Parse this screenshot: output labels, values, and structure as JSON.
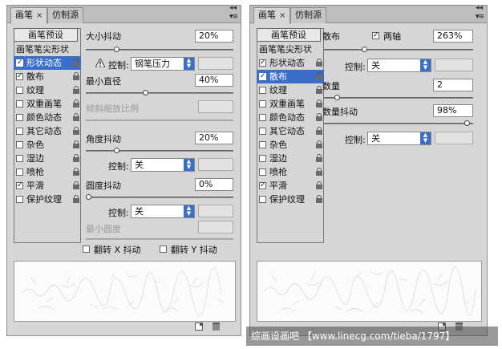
{
  "left_panel": {
    "tabs": [
      {
        "label": "画笔",
        "close": "×",
        "active": true
      },
      {
        "label": "仿制源",
        "active": false
      }
    ],
    "presets_button": "画笔预设",
    "list_header": "画笔笔尖形状",
    "items": [
      {
        "label": "形状动态",
        "checked": true,
        "selected": true
      },
      {
        "label": "散布",
        "checked": true,
        "selected": false
      },
      {
        "label": "纹理",
        "checked": false,
        "selected": false
      },
      {
        "label": "双重画笔",
        "checked": false,
        "selected": false
      },
      {
        "label": "颜色动态",
        "checked": false,
        "selected": false
      },
      {
        "label": "其它动态",
        "checked": false,
        "selected": false
      },
      {
        "label": "杂色",
        "checked": false,
        "selected": false
      },
      {
        "label": "湿边",
        "checked": false,
        "selected": false
      },
      {
        "label": "喷枪",
        "checked": false,
        "selected": false
      },
      {
        "label": "平滑",
        "checked": true,
        "selected": false
      },
      {
        "label": "保护纹理",
        "checked": false,
        "selected": false
      }
    ],
    "size_jitter": {
      "label": "大小抖动",
      "value": "20%",
      "level": 0.2
    },
    "control1": {
      "label": "控制:",
      "value": "钢笔压力",
      "icon": "warning-icon"
    },
    "min_diameter": {
      "label": "最小直径",
      "value": "40%",
      "level": 0.4
    },
    "tilt_scale": {
      "label": "倾斜缩放比例"
    },
    "angle_jitter": {
      "label": "角度抖动",
      "value": "20%",
      "level": 0.2
    },
    "control2": {
      "label": "控制:",
      "value": "关"
    },
    "roundness_jitter": {
      "label": "圆度抖动",
      "value": "0%",
      "level": 0.0
    },
    "control3": {
      "label": "控制:",
      "value": "关"
    },
    "min_roundness": {
      "label": "最小圆度"
    },
    "flip_x": {
      "label": "翻转 X 抖动",
      "checked": false
    },
    "flip_y": {
      "label": "翻转 Y 抖动",
      "checked": false
    }
  },
  "right_panel": {
    "tabs": [
      {
        "label": "画笔",
        "close": "×",
        "active": true
      },
      {
        "label": "仿制源",
        "active": false
      }
    ],
    "presets_button": "画笔预设",
    "list_header": "画笔笔尖形状",
    "items": [
      {
        "label": "形状动态",
        "checked": true,
        "selected": false
      },
      {
        "label": "散布",
        "checked": true,
        "selected": true
      },
      {
        "label": "纹理",
        "checked": false,
        "selected": false
      },
      {
        "label": "双重画笔",
        "checked": false,
        "selected": false
      },
      {
        "label": "颜色动态",
        "checked": false,
        "selected": false
      },
      {
        "label": "其它动态",
        "checked": false,
        "selected": false
      },
      {
        "label": "杂色",
        "checked": false,
        "selected": false
      },
      {
        "label": "湿边",
        "checked": false,
        "selected": false
      },
      {
        "label": "喷枪",
        "checked": false,
        "selected": false
      },
      {
        "label": "平滑",
        "checked": true,
        "selected": false
      },
      {
        "label": "保护纹理",
        "checked": false,
        "selected": false
      }
    ],
    "scatter": {
      "label": "散布",
      "both_axes_label": "两轴",
      "both_axes_checked": true,
      "value": "263%",
      "level": 0.26
    },
    "control1": {
      "label": "控制:",
      "value": "关"
    },
    "count": {
      "label": "数量",
      "value": "2",
      "level": 0.07
    },
    "count_jitter": {
      "label": "数量抖动",
      "value": "98%",
      "level": 0.98
    },
    "control2": {
      "label": "控制:",
      "value": "关"
    }
  },
  "watermark": "综画设画吧 【www.linecg.com/tieba/1797】"
}
